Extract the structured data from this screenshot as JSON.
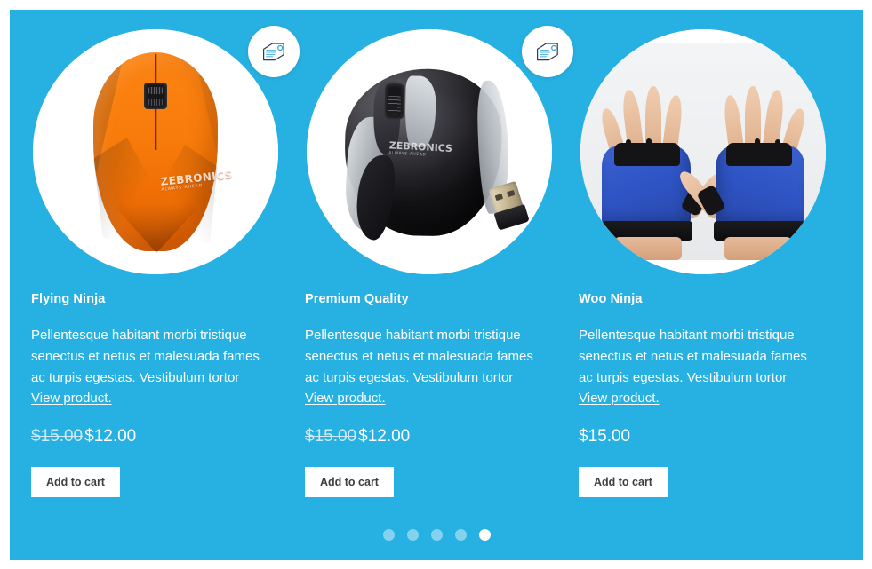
{
  "carousel": {
    "background_color": "#27b0e2",
    "products": [
      {
        "title": "Flying Ninja",
        "description": "Pellentesque habitant morbi tristique senectus et netus et malesuada fames ac turpis egestas. Vestibulum tortor ",
        "link_label": "View product.",
        "price_old": "$15.00",
        "price_new": "$12.00",
        "on_sale": true,
        "badge_icon": "price-tag-icon",
        "add_to_cart_label": "Add to cart",
        "image_alt": "orange faceted wireless mouse"
      },
      {
        "title": "Premium Quality",
        "description": "Pellentesque habitant morbi tristique senectus et netus et malesuada fames ac turpis egestas. Vestibulum tortor ",
        "link_label": "View product.",
        "price_old": "$15.00",
        "price_new": "$12.00",
        "on_sale": true,
        "badge_icon": "price-tag-icon",
        "add_to_cart_label": "Add to cart",
        "image_alt": "black and silver wireless mouse with usb dongle"
      },
      {
        "title": "Woo Ninja",
        "description": "Pellentesque habitant morbi tristique senectus et netus et malesuada fames ac turpis egestas. Vestibulum tortor ",
        "link_label": "View product.",
        "price_old": "",
        "price_new": "$15.00",
        "on_sale": false,
        "badge_icon": "",
        "add_to_cart_label": "Add to cart",
        "image_alt": "blue fingerless gloves worn on two hands"
      }
    ],
    "pagination": {
      "total": 5,
      "active_index": 5,
      "dot_color": "#84d2ee",
      "active_dot_color": "#ffffff"
    }
  }
}
